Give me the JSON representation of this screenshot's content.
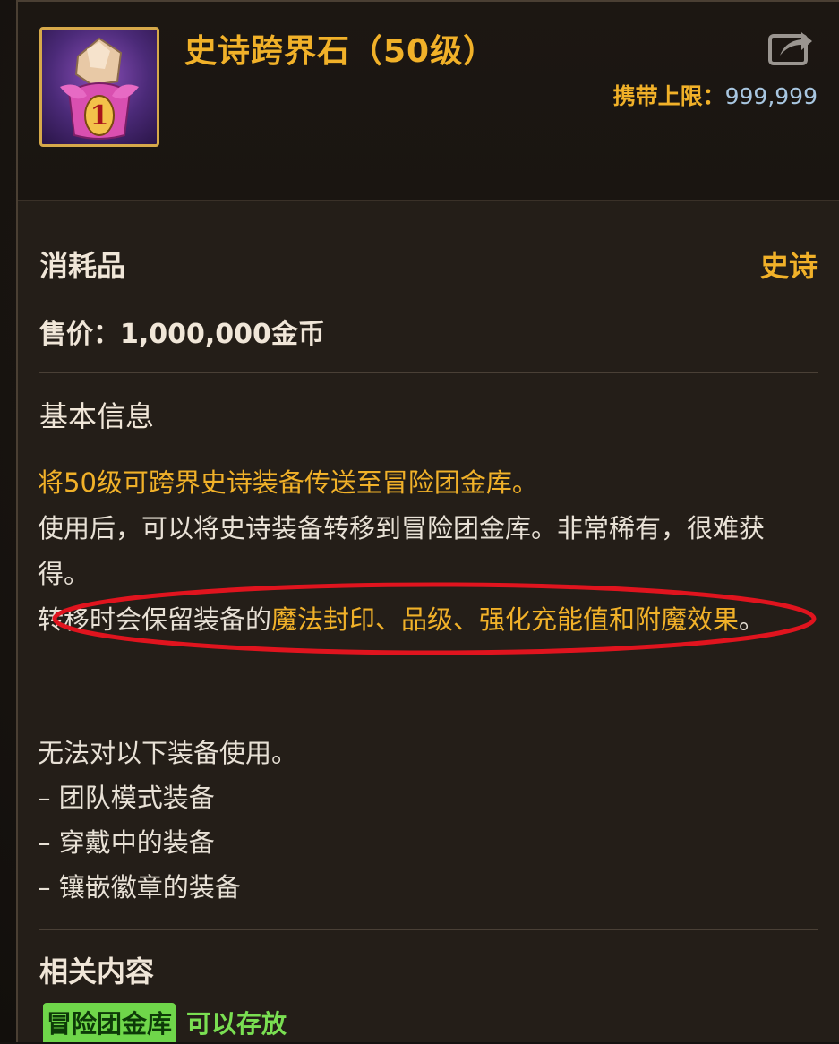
{
  "item": {
    "title": "史诗跨界石（50级）",
    "carry_label": "携带上限：",
    "carry_value": "999,999",
    "category": "消耗品",
    "rarity": "史诗",
    "price": "售价：1,000,000金币"
  },
  "basic_info": {
    "heading": "基本信息",
    "line1": "将50级可跨界史诗装备传送至冒险团金库。",
    "line2": "使用后，可以将史诗装备转移到冒险团金库。非常稀有，很难获得。",
    "line3_plain": "转移时会保留装备的",
    "line3_highlight": "魔法封印、品级、强化充能值和附魔效果",
    "line3_end": "。",
    "restrict_heading": "无法对以下装备使用。",
    "restrictions": [
      "– 团队模式装备",
      "– 穿戴中的装备",
      "– 镶嵌徽章的装备"
    ]
  },
  "related": {
    "heading": "相关内容",
    "tag": "冒险团金库",
    "tag_text": "可以存放"
  },
  "colors": {
    "gold": "#f1b129",
    "green": "#6fd64a",
    "annotation": "#e0141e"
  },
  "icons": [
    "item-gem-icon",
    "share-icon"
  ]
}
